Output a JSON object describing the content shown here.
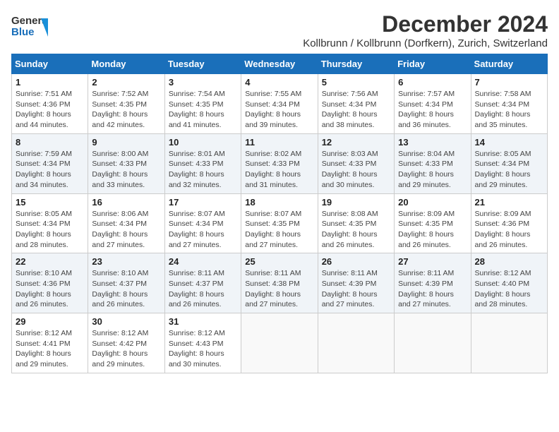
{
  "logo": {
    "general": "General",
    "blue": "Blue"
  },
  "header": {
    "title": "December 2024",
    "subtitle": "Kollbrunn / Kollbrunn (Dorfkern), Zurich, Switzerland"
  },
  "days_of_week": [
    "Sunday",
    "Monday",
    "Tuesday",
    "Wednesday",
    "Thursday",
    "Friday",
    "Saturday"
  ],
  "weeks": [
    [
      {
        "day": "1",
        "sunrise": "Sunrise: 7:51 AM",
        "sunset": "Sunset: 4:36 PM",
        "daylight": "Daylight: 8 hours and 44 minutes."
      },
      {
        "day": "2",
        "sunrise": "Sunrise: 7:52 AM",
        "sunset": "Sunset: 4:35 PM",
        "daylight": "Daylight: 8 hours and 42 minutes."
      },
      {
        "day": "3",
        "sunrise": "Sunrise: 7:54 AM",
        "sunset": "Sunset: 4:35 PM",
        "daylight": "Daylight: 8 hours and 41 minutes."
      },
      {
        "day": "4",
        "sunrise": "Sunrise: 7:55 AM",
        "sunset": "Sunset: 4:34 PM",
        "daylight": "Daylight: 8 hours and 39 minutes."
      },
      {
        "day": "5",
        "sunrise": "Sunrise: 7:56 AM",
        "sunset": "Sunset: 4:34 PM",
        "daylight": "Daylight: 8 hours and 38 minutes."
      },
      {
        "day": "6",
        "sunrise": "Sunrise: 7:57 AM",
        "sunset": "Sunset: 4:34 PM",
        "daylight": "Daylight: 8 hours and 36 minutes."
      },
      {
        "day": "7",
        "sunrise": "Sunrise: 7:58 AM",
        "sunset": "Sunset: 4:34 PM",
        "daylight": "Daylight: 8 hours and 35 minutes."
      }
    ],
    [
      {
        "day": "8",
        "sunrise": "Sunrise: 7:59 AM",
        "sunset": "Sunset: 4:34 PM",
        "daylight": "Daylight: 8 hours and 34 minutes."
      },
      {
        "day": "9",
        "sunrise": "Sunrise: 8:00 AM",
        "sunset": "Sunset: 4:33 PM",
        "daylight": "Daylight: 8 hours and 33 minutes."
      },
      {
        "day": "10",
        "sunrise": "Sunrise: 8:01 AM",
        "sunset": "Sunset: 4:33 PM",
        "daylight": "Daylight: 8 hours and 32 minutes."
      },
      {
        "day": "11",
        "sunrise": "Sunrise: 8:02 AM",
        "sunset": "Sunset: 4:33 PM",
        "daylight": "Daylight: 8 hours and 31 minutes."
      },
      {
        "day": "12",
        "sunrise": "Sunrise: 8:03 AM",
        "sunset": "Sunset: 4:33 PM",
        "daylight": "Daylight: 8 hours and 30 minutes."
      },
      {
        "day": "13",
        "sunrise": "Sunrise: 8:04 AM",
        "sunset": "Sunset: 4:33 PM",
        "daylight": "Daylight: 8 hours and 29 minutes."
      },
      {
        "day": "14",
        "sunrise": "Sunrise: 8:05 AM",
        "sunset": "Sunset: 4:34 PM",
        "daylight": "Daylight: 8 hours and 29 minutes."
      }
    ],
    [
      {
        "day": "15",
        "sunrise": "Sunrise: 8:05 AM",
        "sunset": "Sunset: 4:34 PM",
        "daylight": "Daylight: 8 hours and 28 minutes."
      },
      {
        "day": "16",
        "sunrise": "Sunrise: 8:06 AM",
        "sunset": "Sunset: 4:34 PM",
        "daylight": "Daylight: 8 hours and 27 minutes."
      },
      {
        "day": "17",
        "sunrise": "Sunrise: 8:07 AM",
        "sunset": "Sunset: 4:34 PM",
        "daylight": "Daylight: 8 hours and 27 minutes."
      },
      {
        "day": "18",
        "sunrise": "Sunrise: 8:07 AM",
        "sunset": "Sunset: 4:35 PM",
        "daylight": "Daylight: 8 hours and 27 minutes."
      },
      {
        "day": "19",
        "sunrise": "Sunrise: 8:08 AM",
        "sunset": "Sunset: 4:35 PM",
        "daylight": "Daylight: 8 hours and 26 minutes."
      },
      {
        "day": "20",
        "sunrise": "Sunrise: 8:09 AM",
        "sunset": "Sunset: 4:35 PM",
        "daylight": "Daylight: 8 hours and 26 minutes."
      },
      {
        "day": "21",
        "sunrise": "Sunrise: 8:09 AM",
        "sunset": "Sunset: 4:36 PM",
        "daylight": "Daylight: 8 hours and 26 minutes."
      }
    ],
    [
      {
        "day": "22",
        "sunrise": "Sunrise: 8:10 AM",
        "sunset": "Sunset: 4:36 PM",
        "daylight": "Daylight: 8 hours and 26 minutes."
      },
      {
        "day": "23",
        "sunrise": "Sunrise: 8:10 AM",
        "sunset": "Sunset: 4:37 PM",
        "daylight": "Daylight: 8 hours and 26 minutes."
      },
      {
        "day": "24",
        "sunrise": "Sunrise: 8:11 AM",
        "sunset": "Sunset: 4:37 PM",
        "daylight": "Daylight: 8 hours and 26 minutes."
      },
      {
        "day": "25",
        "sunrise": "Sunrise: 8:11 AM",
        "sunset": "Sunset: 4:38 PM",
        "daylight": "Daylight: 8 hours and 27 minutes."
      },
      {
        "day": "26",
        "sunrise": "Sunrise: 8:11 AM",
        "sunset": "Sunset: 4:39 PM",
        "daylight": "Daylight: 8 hours and 27 minutes."
      },
      {
        "day": "27",
        "sunrise": "Sunrise: 8:11 AM",
        "sunset": "Sunset: 4:39 PM",
        "daylight": "Daylight: 8 hours and 27 minutes."
      },
      {
        "day": "28",
        "sunrise": "Sunrise: 8:12 AM",
        "sunset": "Sunset: 4:40 PM",
        "daylight": "Daylight: 8 hours and 28 minutes."
      }
    ],
    [
      {
        "day": "29",
        "sunrise": "Sunrise: 8:12 AM",
        "sunset": "Sunset: 4:41 PM",
        "daylight": "Daylight: 8 hours and 29 minutes."
      },
      {
        "day": "30",
        "sunrise": "Sunrise: 8:12 AM",
        "sunset": "Sunset: 4:42 PM",
        "daylight": "Daylight: 8 hours and 29 minutes."
      },
      {
        "day": "31",
        "sunrise": "Sunrise: 8:12 AM",
        "sunset": "Sunset: 4:43 PM",
        "daylight": "Daylight: 8 hours and 30 minutes."
      },
      null,
      null,
      null,
      null
    ]
  ]
}
